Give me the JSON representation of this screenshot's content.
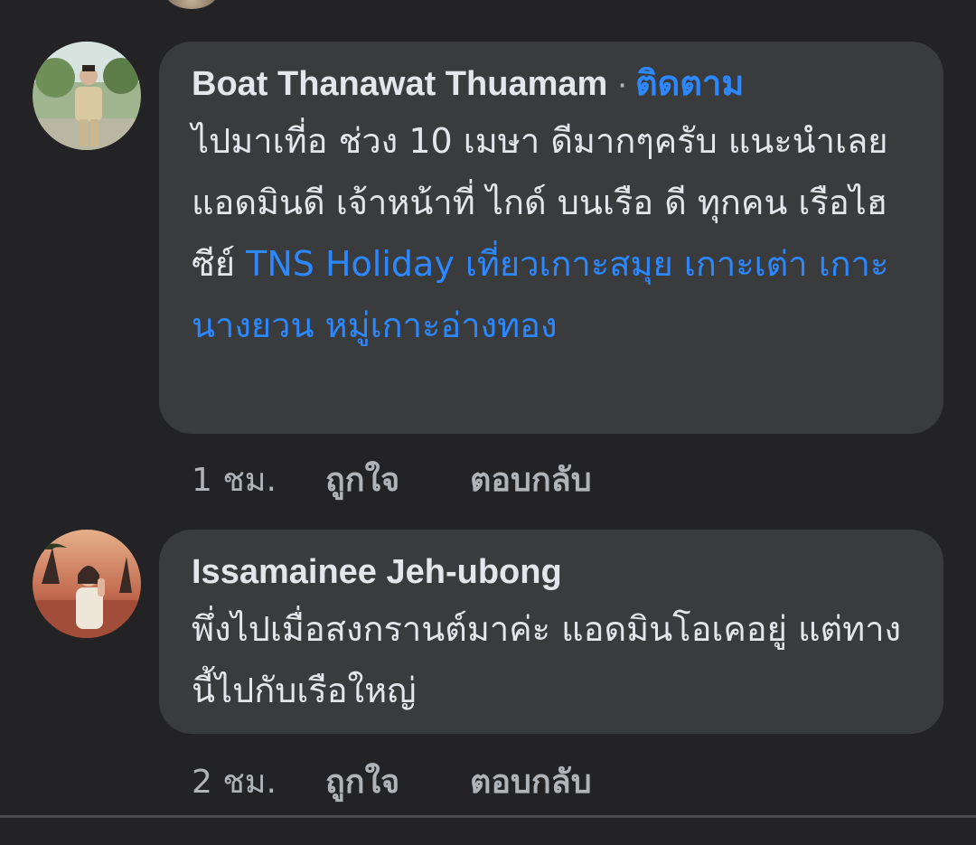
{
  "comments": [
    {
      "author": "Boat Thanawat Thuamam",
      "separator": "·",
      "follow_label": "ติดตาม",
      "text_plain": "ไปมาเที่อ ช่วง 10 เมษา ดีมากๆครับ แนะนำเลย แอดมินดี เจ้าหน้าที่ ไกด์ บนเรือ ดี ทุกคน  เรือไฮซีย์ ",
      "text_link": "TNS Holiday เที่ยวเกาะสมุย เกาะเต่า เกาะนางยวน หมู่เกาะอ่างทอง",
      "time": "1 ชม.",
      "like_label": "ถูกใจ",
      "reply_label": "ตอบกลับ",
      "avatar_icon": "profile-photo-man-uniform"
    },
    {
      "author": "Issamainee Jeh-ubong",
      "text_plain": "พึ่งไปเมื่อสงกรานต์มาค่ะ แอดมินโอเคอยู่ แต่ทางนี้ไปกับเรือใหญ่",
      "time": "2 ชม.",
      "like_label": "ถูกใจ",
      "reply_label": "ตอบกลับ",
      "avatar_icon": "profile-photo-woman-sunset"
    }
  ],
  "colors": {
    "background": "#232325",
    "bubble": "#3a3b3c",
    "text": "#e4e6eb",
    "secondary": "#b0b3b8",
    "link": "#2d88ff"
  }
}
